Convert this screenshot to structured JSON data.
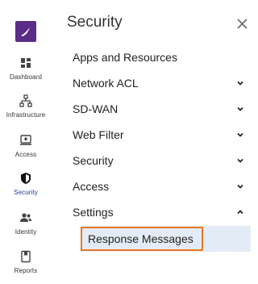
{
  "rail": {
    "items": [
      {
        "label": "Dashboard",
        "icon": "dashboard-icon"
      },
      {
        "label": "Infrastructure",
        "icon": "infrastructure-icon"
      },
      {
        "label": "Access",
        "icon": "access-icon"
      },
      {
        "label": "Security",
        "icon": "shield-icon",
        "active": true
      },
      {
        "label": "Identity",
        "icon": "identity-icon"
      },
      {
        "label": "Reports",
        "icon": "reports-icon"
      }
    ]
  },
  "panel": {
    "title": "Security",
    "menu": [
      {
        "label": "Apps and Resources",
        "expandable": false
      },
      {
        "label": "Network ACL",
        "expandable": true,
        "expanded": false
      },
      {
        "label": "SD-WAN",
        "expandable": true,
        "expanded": false
      },
      {
        "label": "Web Filter",
        "expandable": true,
        "expanded": false
      },
      {
        "label": "Security",
        "expandable": true,
        "expanded": false
      },
      {
        "label": "Access",
        "expandable": true,
        "expanded": false
      },
      {
        "label": "Settings",
        "expandable": true,
        "expanded": true
      }
    ],
    "settings_sub": [
      {
        "label": "Response Messages",
        "selected": true
      }
    ]
  },
  "colors": {
    "brand": "#5b2d86",
    "highlight_bg": "#e3ecf6",
    "focus_border": "#e87722",
    "active_rail": "#1a3a8f"
  }
}
